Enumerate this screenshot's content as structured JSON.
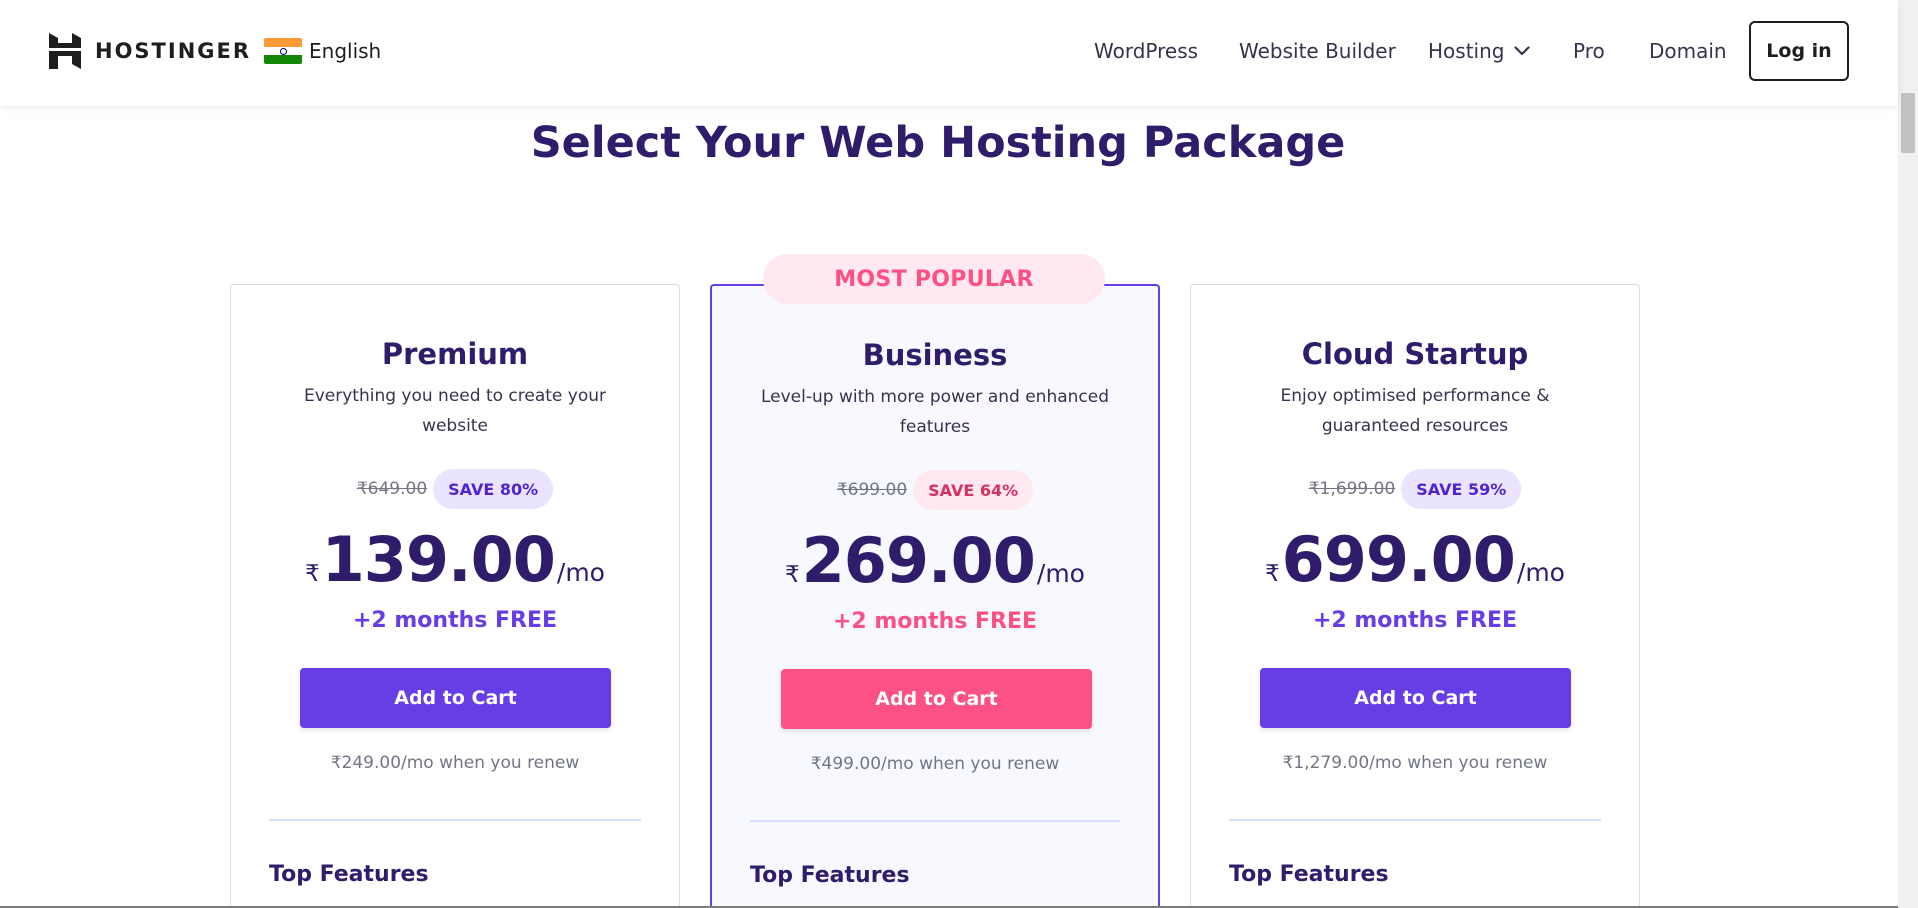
{
  "header": {
    "brand": "HOSTINGER",
    "language": "English",
    "nav": {
      "wordpress": "WordPress",
      "website_builder": "Website Builder",
      "hosting": "Hosting",
      "pro": "Pro",
      "domain": "Domain"
    },
    "login_label": "Log in"
  },
  "page_title": "Select Your Web Hosting Package",
  "popular_badge": "MOST POPULAR",
  "plans": [
    {
      "name": "Premium",
      "description": "Everything you need to create your website",
      "old_price": "₹649.00",
      "save": "SAVE 80%",
      "currency": "₹",
      "price": "139.00",
      "per": "/mo",
      "free": "+2 months FREE",
      "cta": "Add to Cart",
      "renew": "₹249.00/mo when you renew",
      "features_title": "Top Features"
    },
    {
      "name": "Business",
      "description": "Level-up with more power and enhanced features",
      "old_price": "₹699.00",
      "save": "SAVE 64%",
      "currency": "₹",
      "price": "269.00",
      "per": "/mo",
      "free": "+2 months FREE",
      "cta": "Add to Cart",
      "renew": "₹499.00/mo when you renew",
      "features_title": "Top Features"
    },
    {
      "name": "Cloud Startup",
      "description": "Enjoy optimised performance & guaranteed resources",
      "old_price": "₹1,699.00",
      "save": "SAVE 59%",
      "currency": "₹",
      "price": "699.00",
      "per": "/mo",
      "free": "+2 months FREE",
      "cta": "Add to Cart",
      "renew": "₹1,279.00/mo when you renew",
      "features_title": "Top Features"
    }
  ],
  "colors": {
    "primary": "#673de6",
    "accent": "#fc5185",
    "heading": "#2f1c6a"
  },
  "icons": {
    "logo": "hostinger-logo-icon",
    "flag": "india-flag-icon",
    "dropdown": "chevron-down-icon"
  }
}
